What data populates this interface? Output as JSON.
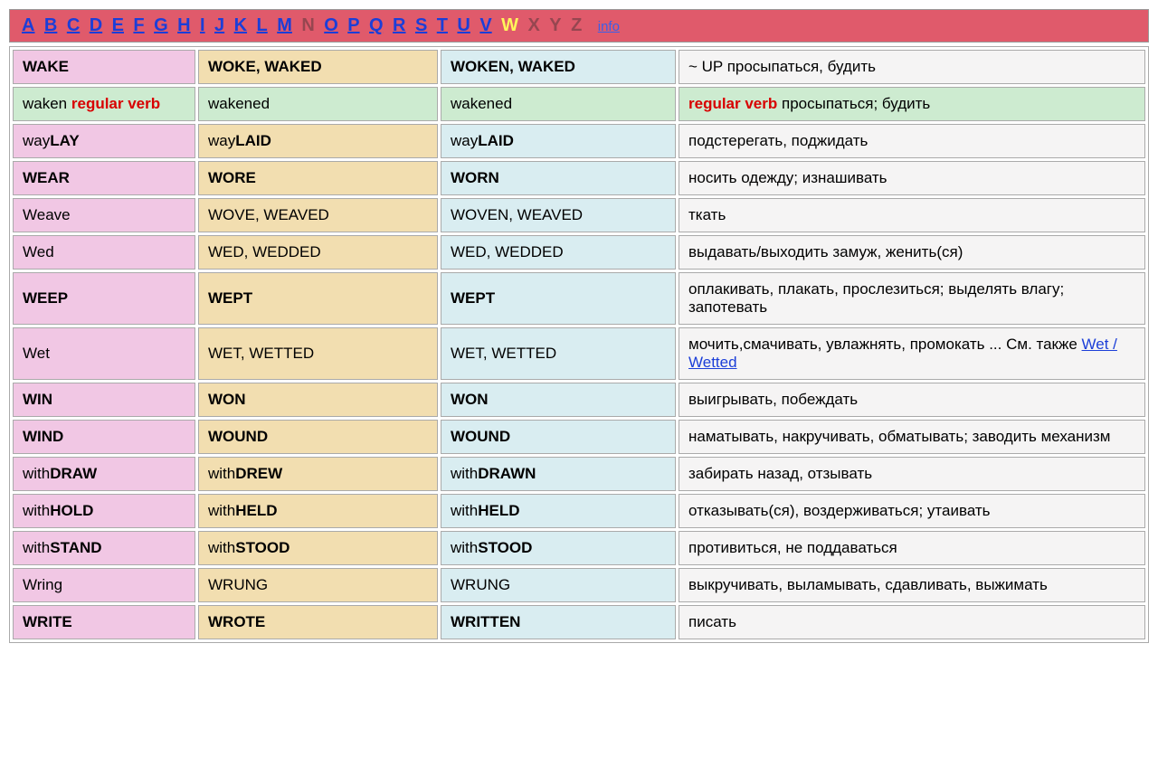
{
  "nav": {
    "letters": [
      {
        "label": "A",
        "type": "link"
      },
      {
        "label": "B",
        "type": "link"
      },
      {
        "label": "C",
        "type": "link"
      },
      {
        "label": "D",
        "type": "link"
      },
      {
        "label": "E",
        "type": "link"
      },
      {
        "label": "F",
        "type": "link"
      },
      {
        "label": "G",
        "type": "link"
      },
      {
        "label": "H",
        "type": "link"
      },
      {
        "label": "I",
        "type": "link"
      },
      {
        "label": "J",
        "type": "link"
      },
      {
        "label": "K",
        "type": "link"
      },
      {
        "label": "L",
        "type": "link"
      },
      {
        "label": "M",
        "type": "link"
      },
      {
        "label": "N",
        "type": "dim"
      },
      {
        "label": "O",
        "type": "link"
      },
      {
        "label": "P",
        "type": "link"
      },
      {
        "label": "Q",
        "type": "link"
      },
      {
        "label": "R",
        "type": "link"
      },
      {
        "label": "S",
        "type": "link"
      },
      {
        "label": "T",
        "type": "link"
      },
      {
        "label": "U",
        "type": "link"
      },
      {
        "label": "V",
        "type": "link"
      },
      {
        "label": "W",
        "type": "current"
      },
      {
        "label": "X",
        "type": "dim"
      },
      {
        "label": "Y",
        "type": "dim"
      },
      {
        "label": "Z",
        "type": "dim"
      }
    ],
    "info": "info"
  },
  "rows": [
    {
      "type": "normal",
      "bold": true,
      "c1": "WAKE",
      "c2": "WOKE, WAKED",
      "c3": "WOKEN, WAKED",
      "c4_prefix": "~ UP   ",
      "c4": "просыпаться, будить"
    },
    {
      "type": "green",
      "bold": false,
      "c1_plain": "waken ",
      "c1_red": "regular verb",
      "c2": "WAKENED",
      "c3": "WAKENED",
      "c4_red": "regular verb ",
      "c4": "просыпаться; будить"
    },
    {
      "type": "mixed",
      "bold": false,
      "c1_a": "WAY",
      "c1_b": "LAY",
      "c2_a": "WAY",
      "c2_b": "LAID",
      "c3_a": "WAY",
      "c3_b": "LAID",
      "c4": "подстерегать, поджидать"
    },
    {
      "type": "normal",
      "bold": true,
      "c1": "WEAR",
      "c2": "WORE",
      "c3": "WORN",
      "c4": "носить одежду; изнашивать"
    },
    {
      "type": "normal",
      "bold": false,
      "c1": "WEAVE",
      "c2": "WOVE, WEAVED",
      "c3": "WOVEN, WEAVED",
      "c4": "ткать"
    },
    {
      "type": "normal",
      "bold": false,
      "c1": "WED",
      "c2": "WED, WEDDED",
      "c3": "WED, WEDDED",
      "c4": "выдавать/выходить замуж, женить(ся)"
    },
    {
      "type": "normal",
      "bold": true,
      "c1": "WEEP",
      "c2": "WEPT",
      "c3": "WEPT",
      "c4": "оплакивать, плакать, прослезиться; выделять влагу; запотевать"
    },
    {
      "type": "withlink",
      "bold": false,
      "c1": "WET",
      "c2": "WET, WETTED",
      "c3": "WET, WETTED",
      "c4": "мочить,смачивать, увлажнять, промокать ...   См. также ",
      "c4_link": "Wet / Wetted"
    },
    {
      "type": "normal",
      "bold": true,
      "c1": "WIN",
      "c2": "WON",
      "c3": "WON",
      "c4": "выигрывать, побеждать"
    },
    {
      "type": "normal",
      "bold": true,
      "c1": "WIND",
      "c2": "WOUND",
      "c3": "WOUND",
      "c4": "наматывать, накручивать, обматывать; заводить механизм"
    },
    {
      "type": "mixed",
      "bold": false,
      "c1_a": "WITH",
      "c1_b": "DRAW",
      "c2_a": "WITH",
      "c2_b": "DREW",
      "c3_a": "WITH",
      "c3_b": "DRAWN",
      "c4": "забирать назад, отзывать"
    },
    {
      "type": "mixed",
      "bold": false,
      "c1_a": "WITH",
      "c1_b": "HOLD",
      "c2_a": "WITH",
      "c2_b": "HELD",
      "c3_a": "WITH",
      "c3_b": "HELD",
      "c4": "отказывать(ся), воздерживаться; утаивать"
    },
    {
      "type": "mixed",
      "bold": false,
      "c1_a": "WITH",
      "c1_b": "STAND",
      "c2_a": "WITH",
      "c2_b": "STOOD",
      "c3_a": "WITH",
      "c3_b": "STOOD",
      "c4": "противиться, не поддаваться"
    },
    {
      "type": "normal",
      "bold": false,
      "c1": "WRING",
      "c2": "WRUNG",
      "c3": "WRUNG",
      "c4": "выкручивать, выламывать, сдавливать, выжимать"
    },
    {
      "type": "normal",
      "bold": true,
      "c1": "WRITE",
      "c2": "WROTE",
      "c3": "WRITTEN",
      "c4": "писать"
    }
  ]
}
